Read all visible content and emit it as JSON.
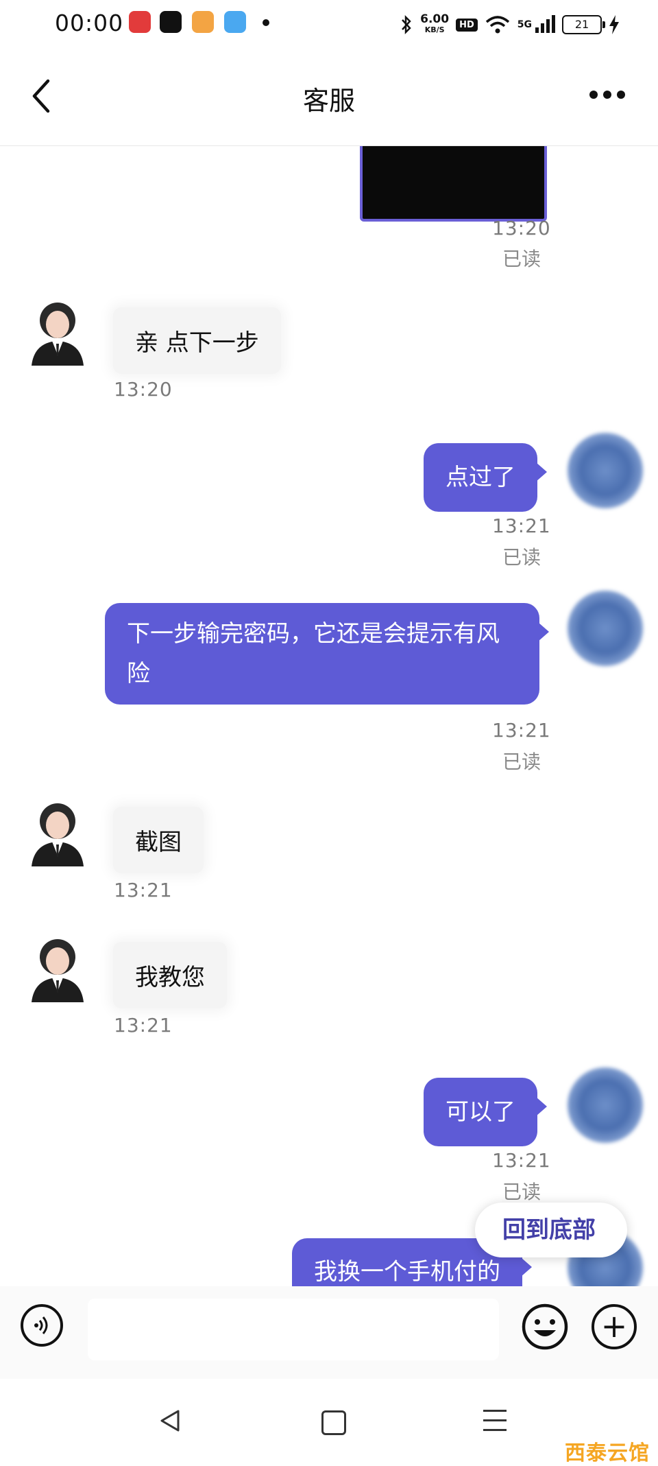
{
  "status_bar": {
    "time": "00:00",
    "net_speed": "6.00",
    "net_unit": "KB/S",
    "hd": "HD",
    "signal": "5G",
    "battery": "21",
    "icons": [
      "video-app-icon",
      "tiktok-icon",
      "media-app-icon",
      "weather-app-icon",
      "bluetooth-icon",
      "wifi-icon",
      "signal-icon",
      "charging-icon"
    ]
  },
  "header": {
    "title": "客服"
  },
  "messages": [
    {
      "side": "out",
      "type": "image",
      "time": "13:20",
      "status": "已读"
    },
    {
      "side": "in",
      "text": "亲  点下一步",
      "time": "13:20"
    },
    {
      "side": "out",
      "text": "点过了",
      "time": "13:21",
      "status": "已读"
    },
    {
      "side": "out",
      "text": "下一步输完密码，它还是会提示有风险",
      "time": "13:21",
      "status": "已读"
    },
    {
      "side": "in",
      "text": "截图",
      "time": "13:21"
    },
    {
      "side": "in",
      "text": "我教您",
      "time": "13:21"
    },
    {
      "side": "out",
      "text": "可以了",
      "time": "13:21",
      "status": "已读"
    },
    {
      "side": "out",
      "text": "我换一个手机付的"
    }
  ],
  "back_to_bottom": "回到底部",
  "watermark": "西泰云馆",
  "colors": {
    "accent": "#5e5bd6",
    "incoming_bubble": "#f4f4f4",
    "watermark": "#f5a623"
  }
}
